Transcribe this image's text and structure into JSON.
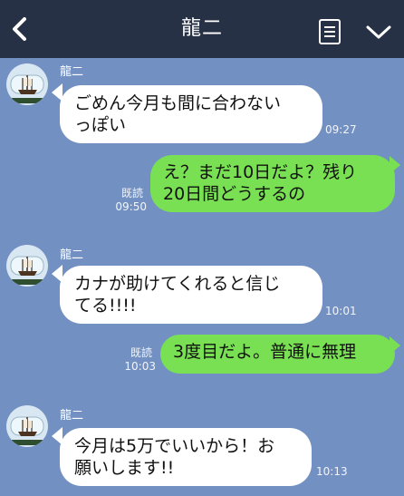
{
  "header": {
    "title": "龍二"
  },
  "messages": [
    {
      "direction": "in",
      "sender": "龍二",
      "text": "ごめん今月も間に合わない\nっぽい",
      "time": "09:27"
    },
    {
      "direction": "out",
      "read": "既読",
      "text": "え？まだ10日だよ？残り\n20日間どうするの",
      "time": "09:50"
    },
    {
      "direction": "in",
      "sender": "龍二",
      "text": "カナが助けてくれると信じ\nてる!!!!",
      "time": "10:01"
    },
    {
      "direction": "out",
      "read": "既読",
      "text": "3度目だよ。普通に無理",
      "time": "10:03"
    },
    {
      "direction": "in",
      "sender": "龍二",
      "text": "今月は5万でいいから！お\n願いします!!",
      "time": "10:13"
    }
  ],
  "colors": {
    "header_bg": "#273146",
    "chat_bg": "#7291c2",
    "incoming_bubble": "#ffffff",
    "outgoing_bubble": "#79e053"
  },
  "icons": {
    "back": "back-chevron-icon",
    "menu": "menu-list-icon",
    "collapse": "chevron-down-icon",
    "avatar": "ship-in-bottle-avatar"
  }
}
